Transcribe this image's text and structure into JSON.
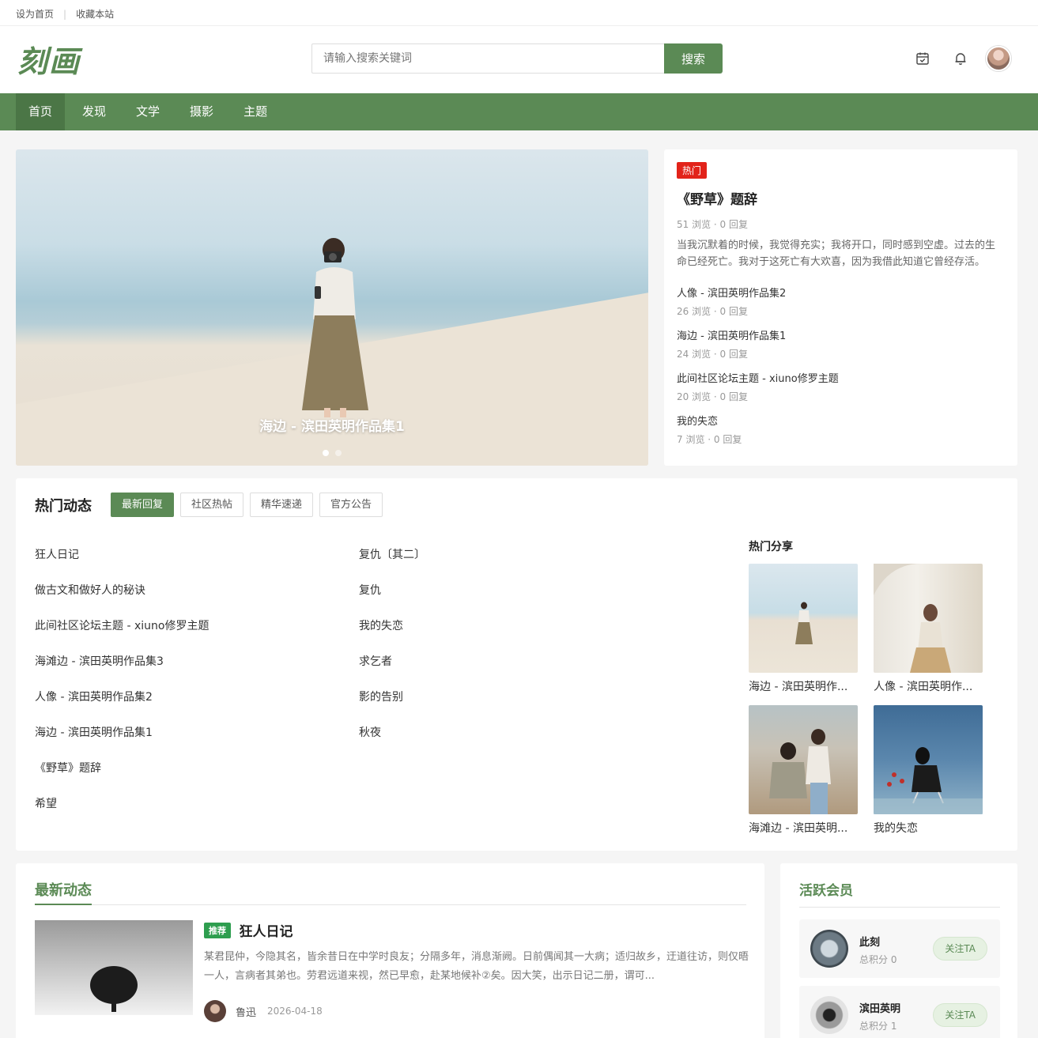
{
  "topbar": {
    "set_home": "设为首页",
    "bookmark": "收藏本站",
    "separator": "|"
  },
  "header": {
    "logo": "刻画",
    "search_placeholder": "请输入搜索关键词",
    "search_button": "搜索"
  },
  "nav": {
    "items": [
      "首页",
      "发现",
      "文学",
      "摄影",
      "主题"
    ],
    "active": "首页"
  },
  "hero": {
    "caption": "海边 - 滨田英明作品集1",
    "slides": 2,
    "active_slide": 1
  },
  "hot": {
    "tag": "热门",
    "title": "《野草》题辞",
    "meta": "51 浏览 · 0 回复",
    "excerpt": "当我沉默着的时候，我觉得充实；我将开口，同时感到空虚。过去的生命已经死亡。我对于这死亡有大欢喜，因为我借此知道它曾经存活。死...",
    "list": [
      {
        "title": "人像 - 滨田英明作品集2",
        "meta": "26 浏览 · 0 回复"
      },
      {
        "title": "海边 - 滨田英明作品集1",
        "meta": "24 浏览 · 0 回复"
      },
      {
        "title": "此间社区论坛主题 - xiuno修罗主题",
        "meta": "20 浏览 · 0 回复"
      },
      {
        "title": "我的失恋",
        "meta": "7 浏览 · 0 回复"
      }
    ]
  },
  "hotdyn": {
    "title": "热门动态",
    "tabs": [
      "最新回复",
      "社区热帖",
      "精华速递",
      "官方公告"
    ],
    "active_tab": "最新回复",
    "left": [
      "狂人日记",
      "做古文和做好人的秘诀",
      "此间社区论坛主题 - xiuno修罗主题",
      "海滩边 - 滨田英明作品集3",
      "人像 - 滨田英明作品集2",
      "海边 - 滨田英明作品集1",
      "《野草》题辞",
      "希望"
    ],
    "right": [
      "复仇〔其二〕",
      "复仇",
      "我的失恋",
      "求乞者",
      "影的告别",
      "秋夜"
    ],
    "share_title": "热门分享",
    "shares": [
      "海边 - 滨田英明作...",
      "人像 - 滨田英明作...",
      "海滩边 - 滨田英明...",
      "我的失恋"
    ]
  },
  "latest": {
    "title": "最新动态",
    "post": {
      "badge": "推荐",
      "title": "狂人日记",
      "excerpt": "某君昆仲，今隐其名，皆余昔日在中学时良友；分隔多年，消息渐阙。日前偶闻其一大病；适归故乡，迂道往访，则仅晤一人，言病者其弟也。劳君远道来视，然已早愈，赴某地候补②矣。因大笑，出示日记二册，谓可...",
      "author": "鲁迅",
      "date": "2026-04-18"
    }
  },
  "members": {
    "title": "活跃会员",
    "list": [
      {
        "name": "此刻",
        "score": "总积分 0",
        "follow": "关注TA"
      },
      {
        "name": "滨田英明",
        "score": "总积分 1",
        "follow": "关注TA"
      }
    ]
  },
  "colors": {
    "brand": "#5b8a55",
    "hot": "#e2231a",
    "recommend": "#2e9e4f"
  }
}
